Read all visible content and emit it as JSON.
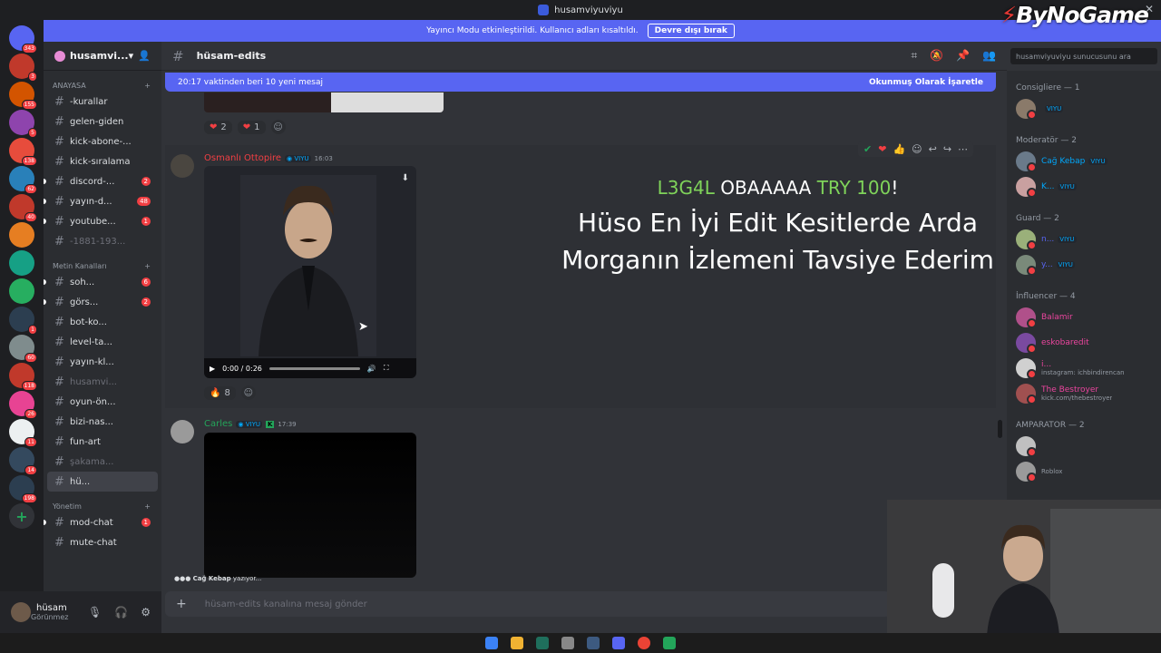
{
  "window": {
    "title": "husamviyuviyu"
  },
  "watermark": {
    "brand": "ByNoGame"
  },
  "banner": {
    "text": "Yayıncı Modu etkinleştirildi. Kullanıcı adları kısaltıldı.",
    "button": "Devre dışı bırak"
  },
  "guilds": [
    {
      "color": "#5865f2",
      "badge": "343"
    },
    {
      "color": "#c0392b",
      "badge": "3"
    },
    {
      "color": "#d35400",
      "badge": "155"
    },
    {
      "color": "#8e44ad",
      "badge": "5"
    },
    {
      "color": "#e74c3c",
      "badge": "138"
    },
    {
      "color": "#2980b9",
      "badge": "62"
    },
    {
      "color": "#c0392b",
      "badge": "40"
    },
    {
      "color": "#e67e22",
      "badge": ""
    },
    {
      "color": "#16a085",
      "badge": ""
    },
    {
      "color": "#27ae60",
      "badge": ""
    },
    {
      "color": "#2c3e50",
      "badge": "1"
    },
    {
      "color": "#7f8c8d",
      "badge": "60"
    },
    {
      "color": "#c0392b",
      "badge": "118"
    },
    {
      "color": "#e84393",
      "badge": "26"
    },
    {
      "color": "#ecf0f1",
      "badge": "11"
    },
    {
      "color": "#34495e",
      "badge": "14"
    },
    {
      "color": "#2c3e50",
      "badge": "198"
    }
  ],
  "server": {
    "name": "husamvi..."
  },
  "categories": {
    "anayasa": "ANAYASA",
    "metin": "Metin Kanalları",
    "yonetim": "Yönetim"
  },
  "channels": [
    {
      "name": "-kurallar",
      "count": "",
      "muted": false
    },
    {
      "name": "gelen-giden",
      "count": "",
      "muted": false
    },
    {
      "name": "kick-abone-...",
      "count": "",
      "muted": false
    },
    {
      "name": "kick-sıralama",
      "count": "",
      "muted": false
    },
    {
      "name": "discord-...",
      "count": "2",
      "muted": false
    },
    {
      "name": "yayın-d...",
      "count": "48",
      "muted": false
    },
    {
      "name": "youtube...",
      "count": "1",
      "muted": false
    },
    {
      "name": "-1881-193...",
      "count": "",
      "muted": true
    }
  ],
  "text_channels": [
    {
      "name": "soh...",
      "count": "6",
      "muted": false
    },
    {
      "name": "görs...",
      "count": "2",
      "muted": false
    },
    {
      "name": "bot-ko...",
      "count": "",
      "muted": false
    },
    {
      "name": "level-ta...",
      "count": "",
      "muted": false
    },
    {
      "name": "yayın-kl...",
      "count": "",
      "muted": false
    },
    {
      "name": "husamvi...",
      "count": "",
      "muted": true
    },
    {
      "name": "oyun-ön...",
      "count": "",
      "muted": false
    },
    {
      "name": "bizi-nas...",
      "count": "",
      "muted": false
    },
    {
      "name": "fun-art",
      "count": "",
      "muted": false
    },
    {
      "name": "şakama...",
      "count": "",
      "muted": true
    },
    {
      "name": "hü...",
      "count": "",
      "muted": false
    }
  ],
  "admin_channels": [
    {
      "name": "mod-chat",
      "count": "1"
    },
    {
      "name": "mute-chat",
      "count": ""
    }
  ],
  "user": {
    "name": "hüsam",
    "status": "Görünmez"
  },
  "header": {
    "channel": "hüsam-edits"
  },
  "search": {
    "placeholder": "husamviyuviyu sunucusunu ara"
  },
  "newbar": {
    "text": "20:17 vaktinden beri 10 yeni mesaj",
    "mark": "Okunmuş Olarak İşaretle"
  },
  "reactions_top": [
    {
      "emoji": "❤",
      "count": "2"
    },
    {
      "emoji": "❤",
      "count": "1"
    }
  ],
  "message1": {
    "author": "Osmanlı Ottopire",
    "tag": "VIYU",
    "time": "16:03",
    "video_time": "0:00 / 0:26",
    "reaction": "8",
    "author_color": "#f23f43"
  },
  "overlay": {
    "w1": "L3G4L",
    "w2": "OBAAAAA",
    "w3": "TRY 100",
    "w4": "!",
    "line2": "Hüso En İyi Edit Kesitlerde Arda Morganın İzlemeni Tavsiye Ederim"
  },
  "message2": {
    "author": "Carles",
    "tag": "VIYU",
    "time": "17:39",
    "author_color": "#23a55a"
  },
  "typing": {
    "user": "Cağ Kebap",
    "text": "yazıyor..."
  },
  "input": {
    "placeholder": "hüsam-edits kanalına mesaj gönder"
  },
  "member_roles": [
    {
      "title": "Consigliere — 1",
      "members": [
        {
          "name": "",
          "tag": "VIYU",
          "color": "#dbdee1",
          "sub": ""
        }
      ]
    },
    {
      "title": "Moderatör — 2",
      "members": [
        {
          "name": "Cağ Kebap",
          "tag": "VIYU",
          "color": "#00a8fc",
          "sub": ""
        },
        {
          "name": "K...",
          "tag": "VIYU",
          "color": "#00a8fc",
          "sub": ""
        }
      ]
    },
    {
      "title": "Guard — 2",
      "members": [
        {
          "name": "n...",
          "tag": "VIYU",
          "color": "#5865f2",
          "sub": ""
        },
        {
          "name": "y...",
          "tag": "VIYU",
          "color": "#5865f2",
          "sub": ""
        }
      ]
    },
    {
      "title": "İnfluencer — 4",
      "members": [
        {
          "name": "Balamir",
          "tag": "",
          "color": "#eb459e",
          "sub": ""
        },
        {
          "name": "eskobaredit",
          "tag": "",
          "color": "#eb459e",
          "sub": ""
        },
        {
          "name": "i...",
          "tag": "",
          "color": "#eb459e",
          "sub": "instagram: ichbindirencan"
        },
        {
          "name": "The Bestroyer",
          "tag": "",
          "color": "#eb459e",
          "sub": "kick.com/thebestroyer"
        }
      ]
    },
    {
      "title": "AMPARATOR — 2",
      "members": [
        {
          "name": "",
          "tag": "",
          "color": "#dbdee1",
          "sub": ""
        },
        {
          "name": "",
          "tag": "",
          "color": "#dbdee1",
          "sub": "Roblox"
        }
      ]
    }
  ]
}
